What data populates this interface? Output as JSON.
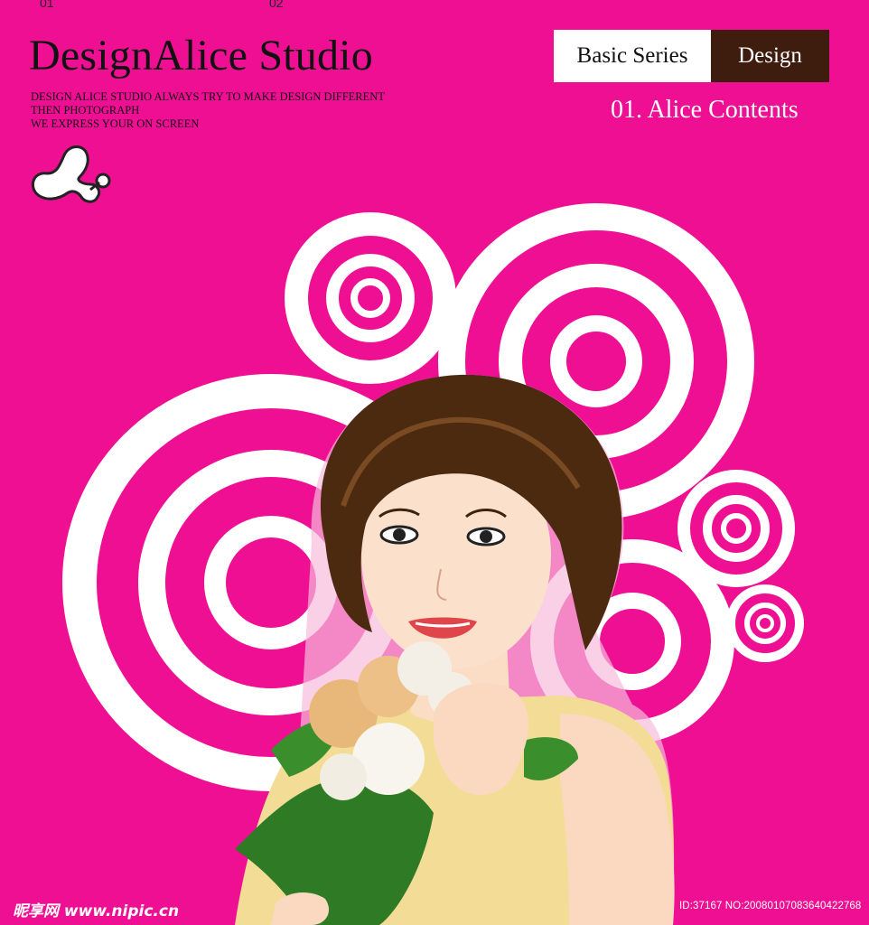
{
  "header": {
    "page_left": "01",
    "page_right": "02",
    "title": "DesignAlice Studio",
    "tagline_lines": [
      "DESIGN ALICE STUDIO ALWAYS TRY TO MAKE DESIGN DIFFERENT",
      "THEN PHOTOGRAPH",
      "WE EXPRESS YOUR ON SCREEN"
    ]
  },
  "tabs": {
    "basic_label": "Basic Series",
    "design_label": "Design"
  },
  "contents_label": "01. Alice Contents",
  "footer": {
    "site_watermark": "昵享网 www.nipic.cn",
    "id_watermark": "ID:37167 NO:20080107083640422768"
  },
  "colors": {
    "background": "#ee0f93",
    "design_tab": "#3f1d0e",
    "rings": "#ffffff"
  },
  "icons": [
    "studio-blob-logo"
  ],
  "illustration": "woman-with-flower-bouquet"
}
